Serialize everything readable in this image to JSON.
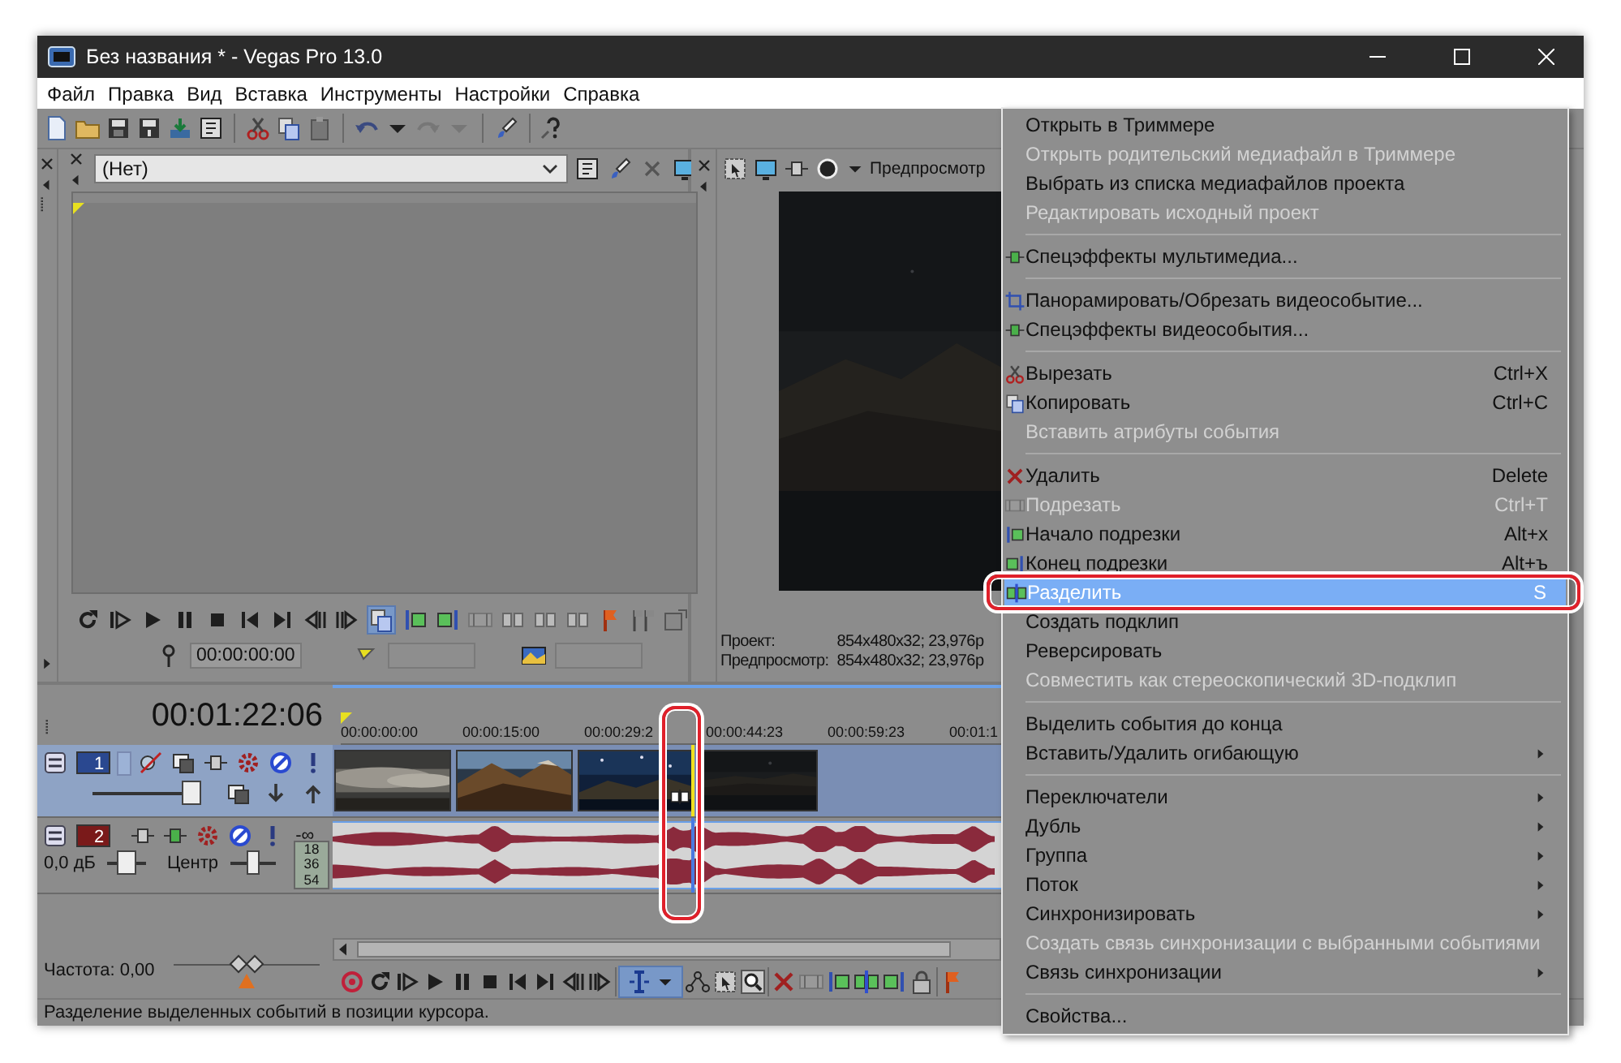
{
  "window": {
    "title": "Без названия * - Vegas Pro 13.0"
  },
  "menu_bar": [
    "Файл",
    "Правка",
    "Вид",
    "Вставка",
    "Инструменты",
    "Настройки",
    "Справка"
  ],
  "trimmer": {
    "source": "(Нет)",
    "timecode": "00:00:00:00"
  },
  "preview": {
    "label": "Предпросмотр",
    "image": {
      "kind": "picture"
    },
    "info": [
      {
        "label": "Проект:",
        "value": "854x480x32; 23,976p"
      },
      {
        "label": "Предпросмотр:",
        "value": "854x480x32; 23,976p"
      }
    ]
  },
  "timeline": {
    "timecode": "00:01:22:06",
    "ruler": [
      "00:00:00:00",
      "00:00:15:00",
      "00:00:29:2",
      "00:00:44:23",
      "00:00:59:23",
      "00:01:1"
    ],
    "tracks": [
      {
        "kind": "video",
        "number": "1",
        "selected": true,
        "level": 0.95,
        "events": [
          {
            "kind": "picture"
          },
          {
            "kind": "picture"
          },
          {
            "kind": "picture"
          },
          {
            "kind": "picture"
          }
        ]
      },
      {
        "kind": "audio",
        "number": "2",
        "selected": false,
        "peak": "-∞",
        "volume": {
          "reading": "0,0 дБ",
          "level": 0.5
        },
        "pan": {
          "reading": "Центр",
          "level": 0.5
        },
        "meter": [
          "18",
          "36",
          "54"
        ]
      }
    ],
    "cursor": {
      "highlighted": true
    },
    "rate": {
      "label": "Частота: 0,00",
      "level": 0.5
    }
  },
  "context_menu": {
    "items": [
      {
        "kind": "item",
        "label": "Открыть в Триммере",
        "disabled": false,
        "selected": false,
        "highlighted": false
      },
      {
        "kind": "item",
        "label": "Открыть родительский медиафайл в Триммере",
        "disabled": true,
        "selected": false,
        "highlighted": false
      },
      {
        "kind": "item",
        "label": "Выбрать из списка медиафайлов проекта",
        "disabled": false,
        "selected": false,
        "highlighted": false
      },
      {
        "kind": "item",
        "label": "Редактировать исходный проект",
        "disabled": true,
        "selected": false,
        "highlighted": false
      },
      {
        "kind": "separator"
      },
      {
        "kind": "item",
        "label": "Спецэффекты мультимедиа...",
        "disabled": false,
        "selected": false,
        "highlighted": false
      },
      {
        "kind": "separator"
      },
      {
        "kind": "item",
        "label": "Панорамировать/Обрезать видеособытие...",
        "disabled": false,
        "selected": false,
        "highlighted": false
      },
      {
        "kind": "item",
        "label": "Спецэффекты видеособытия...",
        "disabled": false,
        "selected": false,
        "highlighted": false
      },
      {
        "kind": "separator"
      },
      {
        "kind": "item",
        "label": "Вырезать",
        "shortcut": "Ctrl+X",
        "disabled": false,
        "selected": false,
        "highlighted": false
      },
      {
        "kind": "item",
        "label": "Копировать",
        "shortcut": "Ctrl+C",
        "disabled": false,
        "selected": false,
        "highlighted": false
      },
      {
        "kind": "item",
        "label": "Вставить атрибуты события",
        "disabled": true,
        "selected": false,
        "highlighted": false
      },
      {
        "kind": "separator"
      },
      {
        "kind": "item",
        "label": "Удалить",
        "shortcut": "Delete",
        "disabled": false,
        "selected": false,
        "highlighted": false
      },
      {
        "kind": "item",
        "label": "Подрезать",
        "shortcut": "Ctrl+T",
        "disabled": true,
        "selected": false,
        "highlighted": false
      },
      {
        "kind": "item",
        "label": "Начало подрезки",
        "shortcut": "Alt+х",
        "disabled": false,
        "selected": false,
        "highlighted": false
      },
      {
        "kind": "item",
        "label": "Конец подрезки",
        "shortcut": "Alt+ъ",
        "disabled": false,
        "selected": false,
        "highlighted": false
      },
      {
        "kind": "item",
        "label": "Разделить",
        "shortcut": "S",
        "disabled": false,
        "selected": true,
        "highlighted": true
      },
      {
        "kind": "item",
        "label": "Создать подклип",
        "disabled": false,
        "selected": false,
        "highlighted": false
      },
      {
        "kind": "item",
        "label": "Реверсировать",
        "disabled": false,
        "selected": false,
        "highlighted": false
      },
      {
        "kind": "item",
        "label": "Совместить как стереоскопический 3D-подклип",
        "disabled": true,
        "selected": false,
        "highlighted": false
      },
      {
        "kind": "separator"
      },
      {
        "kind": "item",
        "label": "Выделить события до конца",
        "disabled": false,
        "selected": false,
        "highlighted": false
      },
      {
        "kind": "submenu",
        "label": "Вставить/Удалить огибающую",
        "disabled": false,
        "selected": false,
        "highlighted": false
      },
      {
        "kind": "separator"
      },
      {
        "kind": "submenu",
        "label": "Переключатели",
        "disabled": false,
        "selected": false,
        "highlighted": false
      },
      {
        "kind": "submenu",
        "label": "Дубль",
        "disabled": false,
        "selected": false,
        "highlighted": false
      },
      {
        "kind": "submenu",
        "label": "Группа",
        "disabled": false,
        "selected": false,
        "highlighted": false
      },
      {
        "kind": "submenu",
        "label": "Поток",
        "disabled": false,
        "selected": false,
        "highlighted": false
      },
      {
        "kind": "submenu",
        "label": "Синхронизировать",
        "disabled": false,
        "selected": false,
        "highlighted": false
      },
      {
        "kind": "item",
        "label": "Создать связь синхронизации с выбранными событиями",
        "disabled": true,
        "selected": false,
        "highlighted": false
      },
      {
        "kind": "submenu",
        "label": "Связь синхронизации",
        "disabled": false,
        "selected": false,
        "highlighted": false
      },
      {
        "kind": "separator"
      },
      {
        "kind": "item",
        "label": "Свойства...",
        "disabled": false,
        "selected": false,
        "highlighted": false
      }
    ]
  },
  "status_bar": "Разделение выделенных событий в позиции курсора."
}
